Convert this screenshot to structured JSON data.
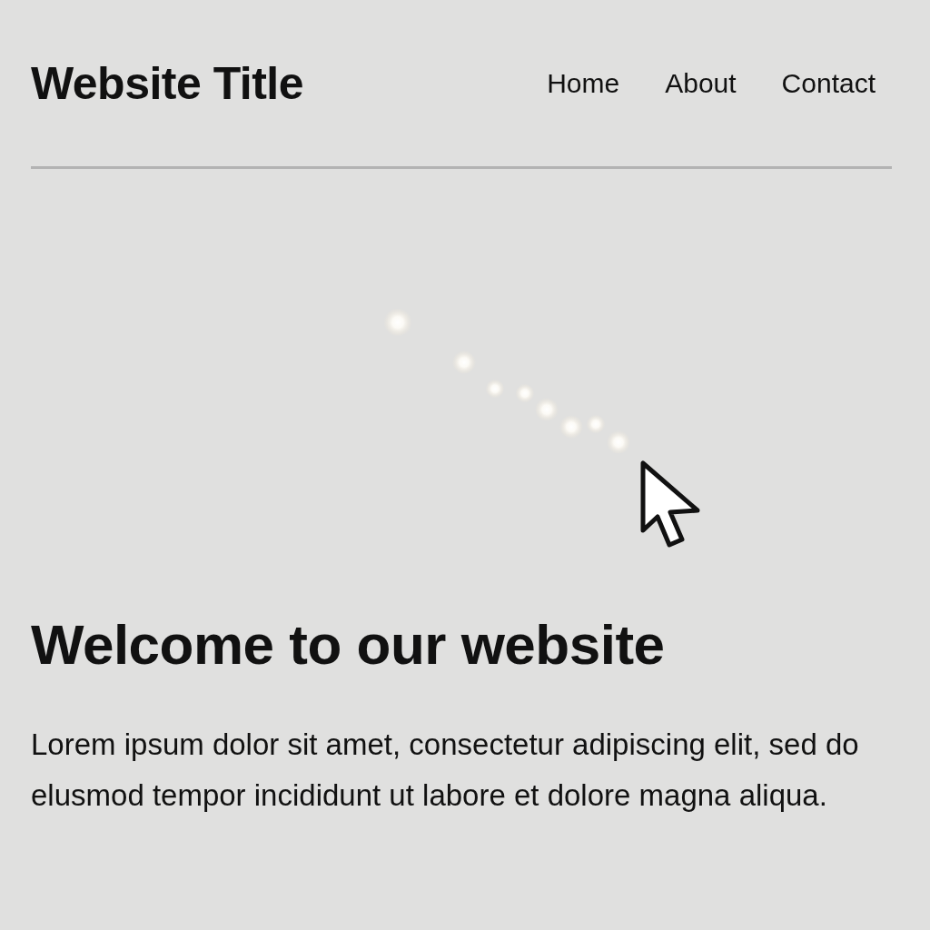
{
  "header": {
    "title": "Website Title",
    "nav": [
      {
        "label": "Home"
      },
      {
        "label": "About"
      },
      {
        "label": "Contact"
      }
    ]
  },
  "hero": {
    "heading": "Welcome to our website",
    "paragraph": "Lorem ipsum dolor sit amet, consectetur adipiscing elit, sed do elusmod tempor incididunt ut labore et dolore magna aliqua."
  }
}
